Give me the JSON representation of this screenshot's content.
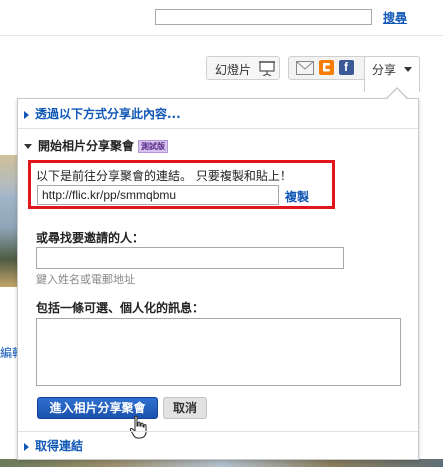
{
  "header": {
    "search_placeholder": "",
    "search_label": "搜尋"
  },
  "toolbar": {
    "slideshow_label": "幻燈片",
    "share_label": "分享",
    "share_icons": [
      "mail-icon",
      "blogger-icon",
      "facebook-icon"
    ]
  },
  "background": {
    "left_text": "編輯"
  },
  "share_panel": {
    "section_share_via": "透過以下方式分享此內容...",
    "section_guest_pass": "開始相片分享聚會",
    "beta_badge": "測試版",
    "intro_text": "以下是前往分享聚會的連結。 只要複製和貼上！",
    "url_value": "http://flic.kr/pp/smmqbmu",
    "copy_label": "複製",
    "invite_label": "或尋找要邀請的人：",
    "invite_hint": "鍵入姓名或電郵地址",
    "message_label": "包括一條可選、個人化的訊息：",
    "message_value": "",
    "primary_button": "進入相片分享聚會",
    "cancel_button": "取消",
    "section_get_link": "取得連結"
  },
  "colors": {
    "link_blue": "#1057b6",
    "highlight_red": "#e0161c",
    "primary_button": "#1a52ad"
  }
}
